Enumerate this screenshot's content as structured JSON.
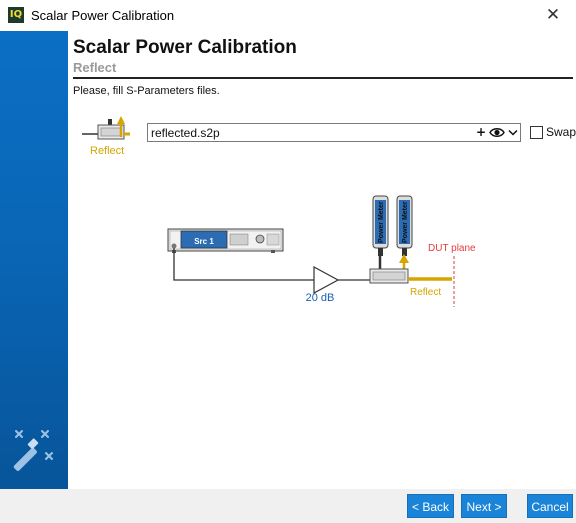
{
  "window": {
    "app_icon_text": "IQ",
    "title": "Scalar Power Calibration",
    "close_glyph": "✕"
  },
  "header": {
    "title": "Scalar Power Calibration",
    "subtitle": "Reflect"
  },
  "instruction": "Please, fill S-Parameters files.",
  "file_row": {
    "thumbnail_label": "Reflect",
    "file_value": "reflected.s2p",
    "add_icon": "plus-icon",
    "view_icon": "eye-icon",
    "dropdown_icon": "chevron-down-icon",
    "swap_label": "Swap",
    "swap_checked": false
  },
  "diagram": {
    "source_label": "Src 1",
    "amplifier_gain": "20 dB",
    "power_meter_1": "Power Meter",
    "power_meter_2": "Power Meter",
    "dut_label": "DUT plane",
    "reflect_label": "Reflect"
  },
  "footer": {
    "back_label": "< Back",
    "next_label": "Next >",
    "cancel_label": "Cancel"
  },
  "colors": {
    "sidebar_blue": "#0a66b6",
    "button_blue": "#1a84d8",
    "gold": "#d6a500",
    "dut_red": "#e53b3b",
    "gain_blue": "#1a5fb4"
  }
}
